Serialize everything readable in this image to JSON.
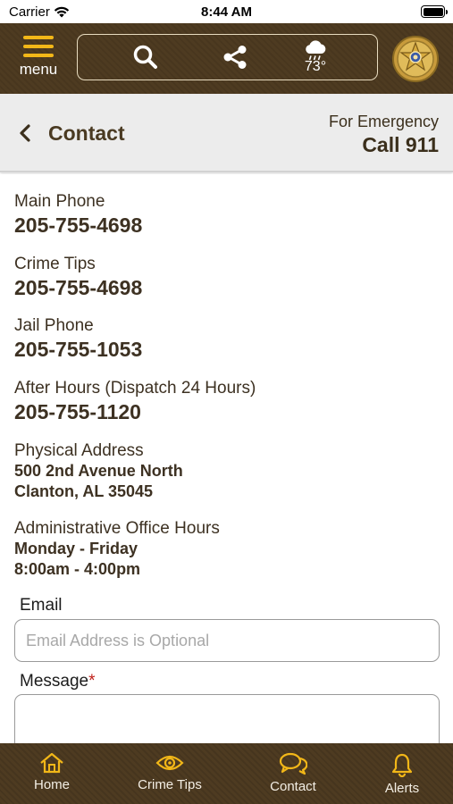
{
  "status_bar": {
    "carrier": "Carrier",
    "time": "8:44 AM"
  },
  "header": {
    "menu_label": "menu",
    "weather_temp": "73°",
    "icons": [
      "menu-icon",
      "search-icon",
      "share-icon",
      "rain-cloud-icon",
      "sheriff-star-badge"
    ]
  },
  "titlebar": {
    "title": "Contact",
    "emergency_label": "For Emergency",
    "emergency_call": "Call 911"
  },
  "contacts": [
    {
      "label": "Main Phone",
      "value": "205-755-4698"
    },
    {
      "label": "Crime Tips",
      "value": "205-755-4698"
    },
    {
      "label": "Jail Phone",
      "value": "205-755-1053"
    },
    {
      "label": "After Hours (Dispatch 24 Hours)",
      "value": "205-755-1120"
    }
  ],
  "address": {
    "label": "Physical Address",
    "line1": "500 2nd Avenue North",
    "line2": "Clanton, AL 35045"
  },
  "office_hours": {
    "label": "Administrative Office Hours",
    "days": "Monday - Friday",
    "hours": "8:00am - 4:00pm"
  },
  "form": {
    "email_label": "Email",
    "email_placeholder": "Email Address is Optional",
    "email_value": "",
    "message_label": "Message",
    "required_mark": "*",
    "message_value": ""
  },
  "bottom_nav": [
    {
      "label": "Home",
      "icon": "home-icon"
    },
    {
      "label": "Crime Tips",
      "icon": "eye-icon"
    },
    {
      "label": "Contact",
      "icon": "chat-bubbles-icon"
    },
    {
      "label": "Alerts",
      "icon": "bell-icon"
    }
  ],
  "colors": {
    "header_brown": "#4e3b21",
    "accent_gold": "#f2b718",
    "text_brown": "#3d3122",
    "required_red": "#c0201a"
  }
}
